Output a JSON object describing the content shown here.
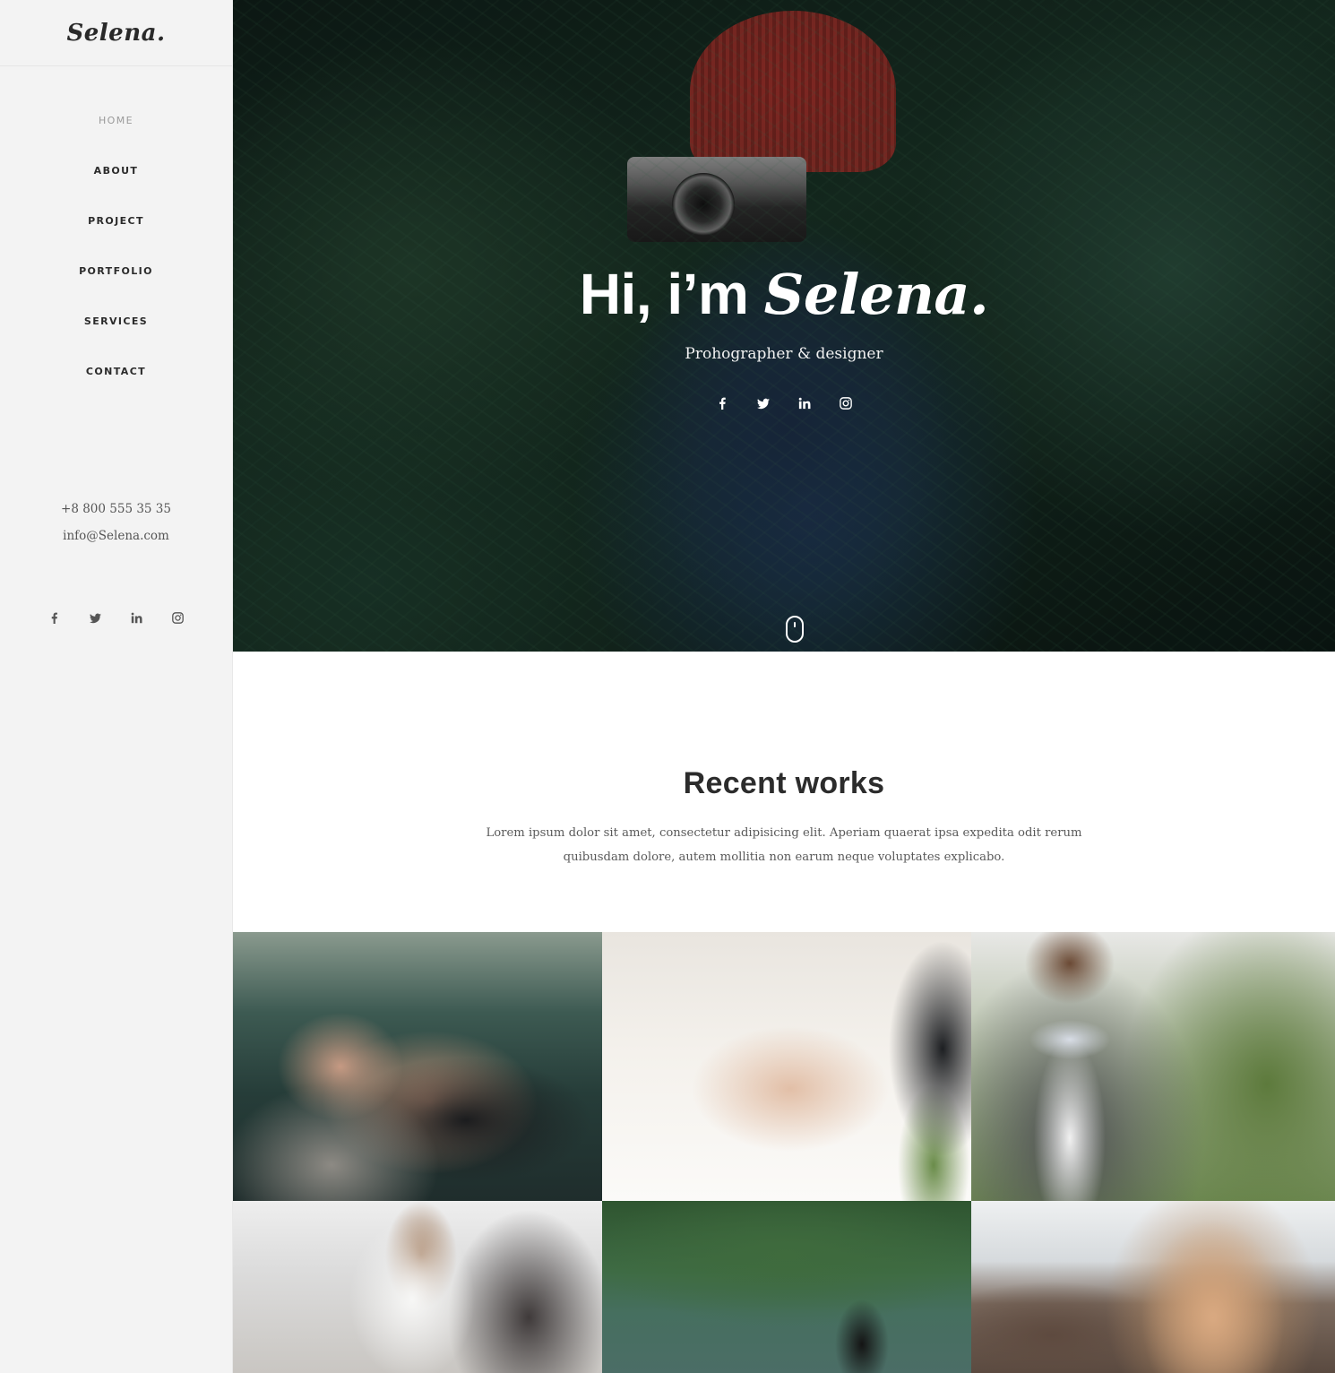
{
  "brand": {
    "logo": "Selena."
  },
  "nav": {
    "items": [
      {
        "label": "HOME",
        "active": true
      },
      {
        "label": "ABOUT",
        "active": false
      },
      {
        "label": "PROJECT",
        "active": false
      },
      {
        "label": "PORTFOLIO",
        "active": false
      },
      {
        "label": "SERVICES",
        "active": false
      },
      {
        "label": "CONTACT",
        "active": false
      }
    ]
  },
  "contact": {
    "phone": "+8 800 555 35 35",
    "email": "info@Selena.com"
  },
  "social_icons": [
    "facebook-icon",
    "twitter-icon",
    "linkedin-icon",
    "instagram-icon"
  ],
  "hero": {
    "title_prefix": "Hi, i’m",
    "title_name": "Selena.",
    "subtitle": "Prohographer & designer",
    "scroll_icon": "mouse-scroll-icon"
  },
  "works": {
    "title": "Recent works",
    "description": "Lorem ipsum dolor sit amet, consectetur adipisicing elit. Aperiam quaerat ipsa expedita odit rerum quibusdam dolore, autem mollitia non earum neque voluptates explicabo.",
    "tiles": 6
  },
  "colors": {
    "sidebar_bg": "#f3f3f3",
    "nav_active": "#9a9a9a",
    "text_dark": "#2c2c2c",
    "hero_text": "#ffffff"
  }
}
